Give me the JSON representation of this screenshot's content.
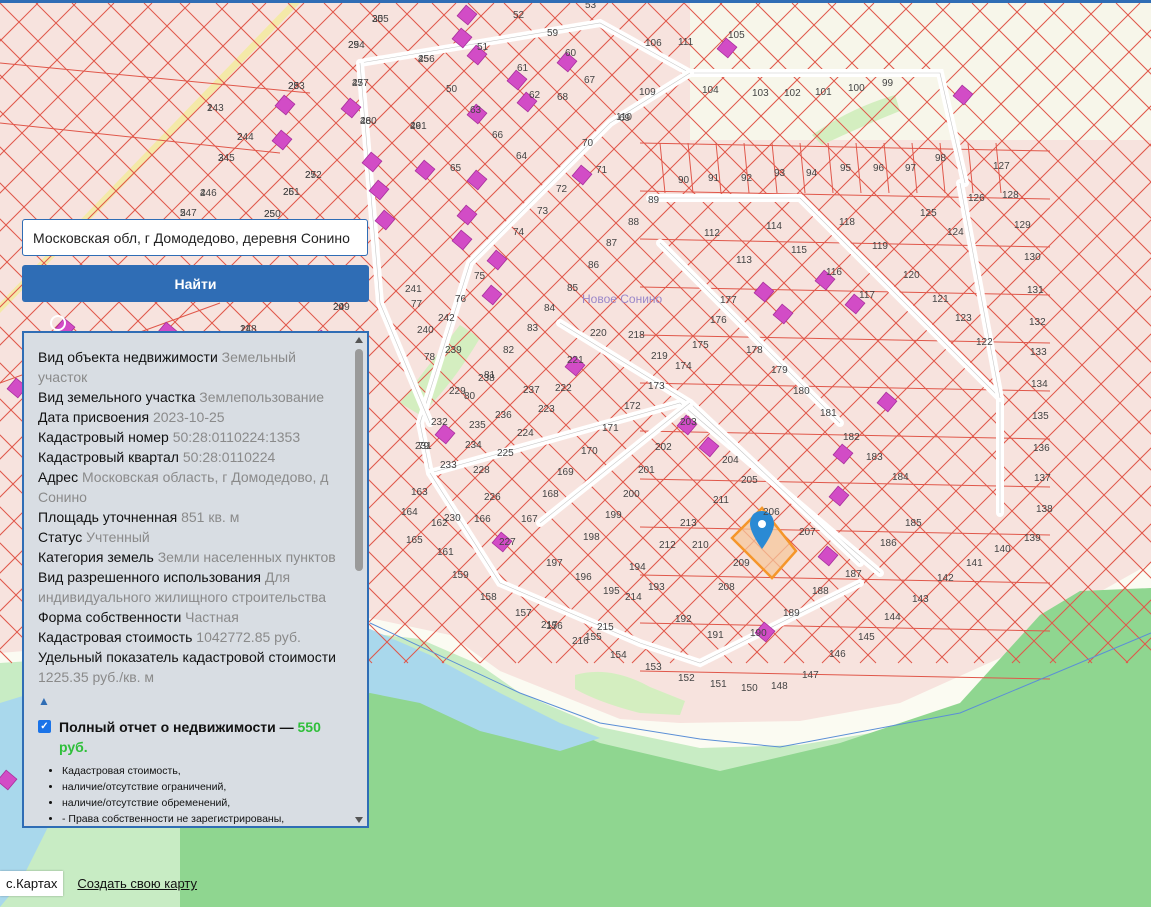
{
  "search": {
    "value": "Московская обл, г Домодедово, деревня Сонино",
    "button_label": "Найти"
  },
  "map": {
    "settlement_label": "Новое Сонино",
    "parcel_numbers": [
      "1",
      "2",
      "3",
      "4",
      "5",
      "11",
      "20",
      "25",
      "26",
      "27",
      "28",
      "29",
      "30",
      "45",
      "47",
      "48",
      "49",
      "50",
      "51",
      "52",
      "53",
      "59",
      "60",
      "61",
      "62",
      "63",
      "64",
      "65",
      "66",
      "67",
      "68",
      "69",
      "70",
      "71",
      "72",
      "73",
      "74",
      "75",
      "76",
      "77",
      "78",
      "79",
      "80",
      "81",
      "82",
      "83",
      "84",
      "85",
      "86",
      "87",
      "88",
      "89",
      "90",
      "91",
      "92",
      "93",
      "94",
      "95",
      "96",
      "97",
      "98",
      "99",
      "100",
      "101",
      "102",
      "103",
      "104",
      "105",
      "106",
      "109",
      "110",
      "111",
      "112",
      "113",
      "114",
      "115",
      "116",
      "117",
      "118",
      "119",
      "120",
      "121",
      "122",
      "123",
      "124",
      "125",
      "126",
      "127",
      "128",
      "129",
      "130",
      "131",
      "132",
      "133",
      "134",
      "135",
      "136",
      "137",
      "138",
      "139",
      "140",
      "141",
      "142",
      "143",
      "144",
      "145",
      "146",
      "147",
      "148",
      "150",
      "151",
      "152",
      "153",
      "154",
      "155",
      "156",
      "157",
      "158",
      "159",
      "161",
      "162",
      "163",
      "164",
      "165",
      "166",
      "167",
      "168",
      "169",
      "170",
      "171",
      "172",
      "173",
      "174",
      "175",
      "176",
      "177",
      "178",
      "179",
      "180",
      "181",
      "182",
      "183",
      "184",
      "185",
      "186",
      "187",
      "188",
      "189",
      "190",
      "191",
      "192",
      "193",
      "194",
      "195",
      "196",
      "197",
      "198",
      "199",
      "200",
      "201",
      "202",
      "203",
      "204",
      "205",
      "206",
      "207",
      "208",
      "209",
      "210",
      "211",
      "212",
      "213",
      "214",
      "215",
      "216",
      "217",
      "218",
      "219",
      "220",
      "221",
      "222",
      "223",
      "224",
      "225",
      "226",
      "227",
      "228",
      "229",
      "230",
      "231",
      "232",
      "233",
      "234",
      "235",
      "236",
      "237",
      "238",
      "239",
      "240",
      "241",
      "242",
      "243",
      "244",
      "245",
      "246",
      "247",
      "248",
      "249",
      "250",
      "251",
      "252",
      "253",
      "254",
      "255",
      "256",
      "257",
      "260",
      "261"
    ],
    "colors": {
      "background": "#f7e3de",
      "parcel_border": "#e0574a",
      "building": "#d24cc6",
      "forest": "#8fd690",
      "water": "#a9d8ec",
      "selected": "#f5962a",
      "marker": "#2a8ad4"
    }
  },
  "info_panel": {
    "rows": [
      {
        "label": "Вид объекта недвижимости",
        "value": "Земельный участок"
      },
      {
        "label": "Вид земельного участка",
        "value": "Землепользование"
      },
      {
        "label": "Дата присвоения",
        "value": "2023-10-25"
      },
      {
        "label": "Кадастровый номер",
        "value": "50:28:0110224:1353"
      },
      {
        "label": "Кадастровый квартал",
        "value": "50:28:0110224"
      },
      {
        "label": "Адрес",
        "value": "Московская область, г Домодедово, д Сонино"
      },
      {
        "label": "Площадь уточненная",
        "value": "851 кв. м"
      },
      {
        "label": "Статус",
        "value": "Учтенный"
      },
      {
        "label": "Категория земель",
        "value": "Земли населенных пунктов"
      },
      {
        "label": "Вид разрешенного использования",
        "value": "Для индивидуального жилищного строительства"
      },
      {
        "label": "Форма собственности",
        "value": "Частная"
      },
      {
        "label": "Кадастровая стоимость",
        "value": "1042772.85 руб."
      },
      {
        "label": "Удельный показатель кадастровой стоимости",
        "value": "1225.35 руб./кв. м"
      }
    ],
    "collapse_icon": "▲",
    "report": {
      "checked": true,
      "title": "Полный отчет о недвижимости — ",
      "price": "550 руб.",
      "items": [
        "Кадастровая стоимость,",
        "наличие/отсутствие ограничений,",
        "наличие/отсутствие обременений,",
        "- Права собственности не зарегистрированы,"
      ]
    }
  },
  "footer": {
    "brand": "с.Картах",
    "create_map": "Создать свою карту"
  }
}
